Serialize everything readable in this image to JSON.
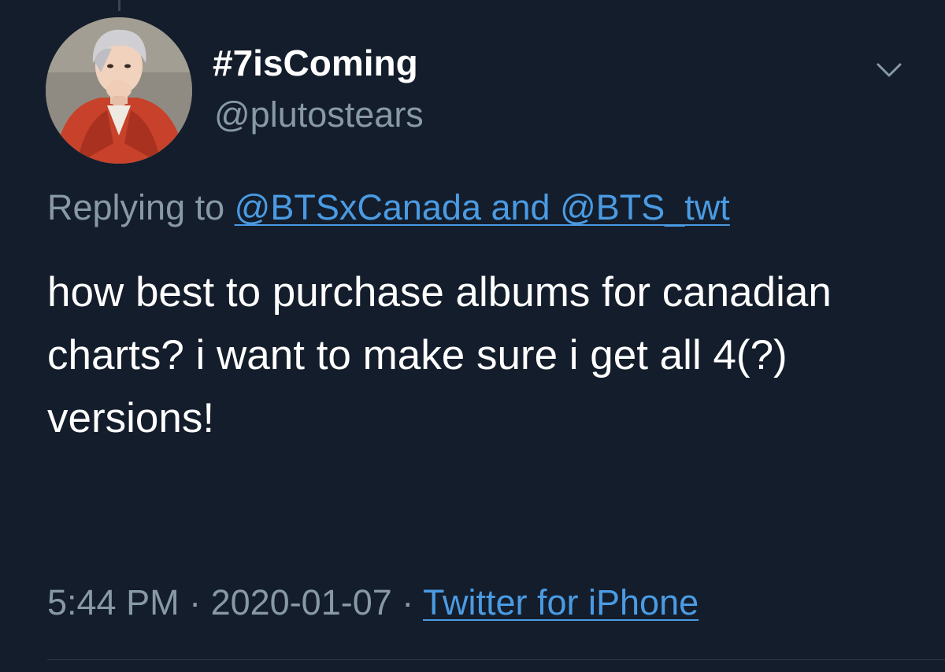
{
  "tweet": {
    "display_name": "#7isComing",
    "handle": "@plutostears",
    "reply_prefix": "Replying to ",
    "reply_user_1": "@BTSxCanada",
    "reply_and": " and ",
    "reply_user_2": "@BTS_twt",
    "text": "how best to purchase albums for canadian charts? i want to make sure i get all 4(?) versions!",
    "time": "5:44 PM",
    "separator": " · ",
    "date": "2020-01-07",
    "source": "Twitter for iPhone"
  },
  "icons": {
    "more": "chevron-down-icon"
  },
  "colors": {
    "background": "#141d2b",
    "primary_text": "#ffffff",
    "secondary_text": "#8899a6",
    "link": "#4a9be3"
  }
}
